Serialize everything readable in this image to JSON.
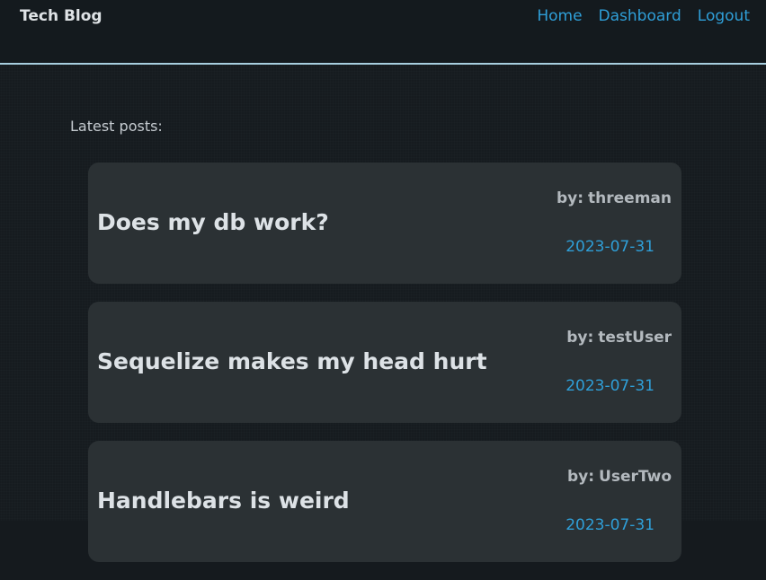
{
  "header": {
    "brand": "Tech Blog",
    "nav": [
      {
        "label": "Home"
      },
      {
        "label": "Dashboard"
      },
      {
        "label": "Logout"
      }
    ]
  },
  "main": {
    "latest_label": "Latest posts:",
    "posts": [
      {
        "title": "Does my db work?",
        "by_label": "by:",
        "author": "threeman",
        "date": "2023-07-31"
      },
      {
        "title": "Sequelize makes my head hurt",
        "by_label": "by:",
        "author": "testUser",
        "date": "2023-07-31"
      },
      {
        "title": "Handlebars is weird",
        "by_label": "by:",
        "author": "UserTwo",
        "date": "2023-07-31"
      }
    ]
  },
  "colors": {
    "background": "#161b1f",
    "card": "#2b3134",
    "link": "#2f9fd8",
    "header_border": "#a8cfe0"
  }
}
